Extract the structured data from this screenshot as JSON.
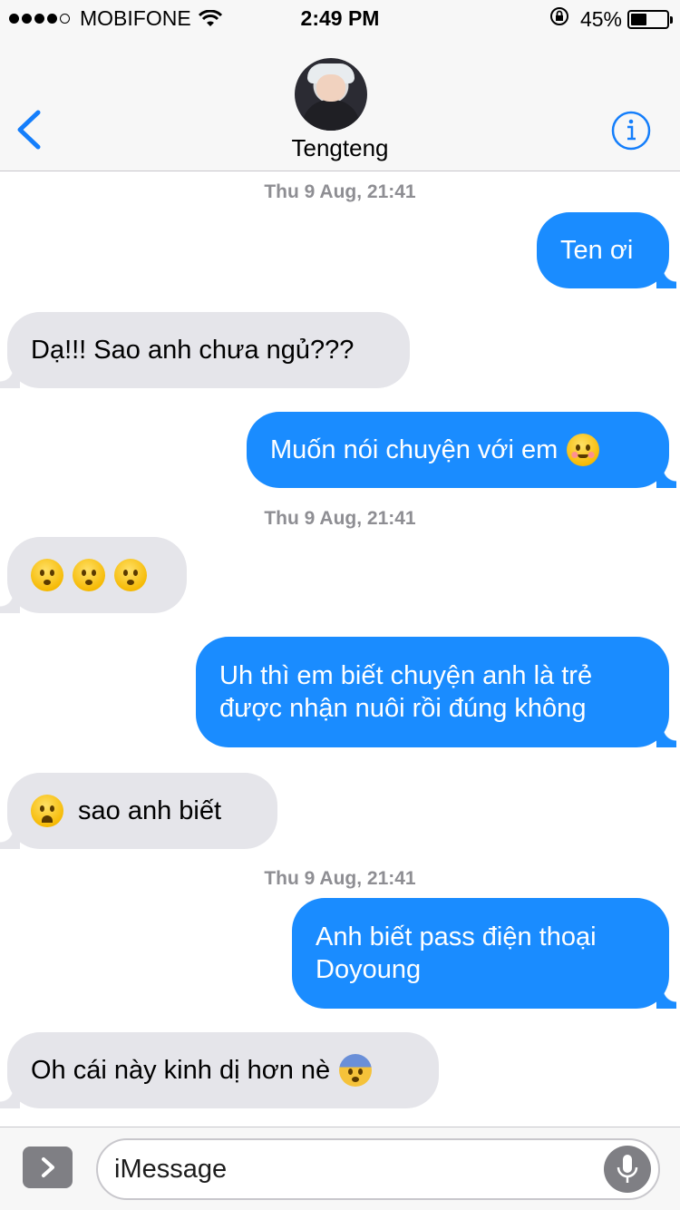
{
  "status_bar": {
    "carrier": "MOBIFONE",
    "time": "2:49 PM",
    "battery": "45%",
    "battery_level": 0.45,
    "signal_bars_filled": 4,
    "signal_bars_total": 5
  },
  "header": {
    "contact_name": "Tengteng",
    "back_icon": "chevron-left-icon",
    "info_icon": "info-icon"
  },
  "colors": {
    "outgoing_bubble": "#1a8cff",
    "incoming_bubble": "#e5e5ea",
    "accent": "#147efb"
  },
  "thread": {
    "timestamp_1": "Thu 9 Aug, 21:41",
    "msg_1": "Ten ơi",
    "msg_2": "Dạ!!! Sao anh chưa ngủ???",
    "msg_3": "Muốn nói chuyện với em",
    "timestamp_2": "Thu 9 Aug, 21:41",
    "msg_4_emoji": "kissing-face-emoji ×3",
    "msg_5_line1": "Uh thì em biết chuyện anh là trẻ",
    "msg_5_line2": "được nhận nuôi rồi đúng không",
    "msg_6": "sao anh biết",
    "timestamp_3": "Thu 9 Aug, 21:41",
    "msg_7_line1": "Anh biết pass điện thoại",
    "msg_7_line2": "Doyoung",
    "msg_8": "Oh cái này kinh dị hơn nè"
  },
  "input_bar": {
    "placeholder": "iMessage",
    "expand_icon": "chevron-right-icon",
    "mic_icon": "microphone-icon"
  }
}
